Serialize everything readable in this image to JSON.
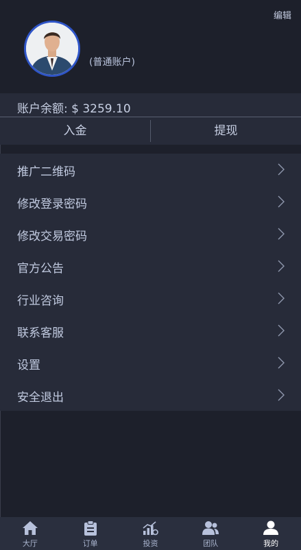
{
  "header": {
    "edit_label": "编辑",
    "account_type": "(普通账户)"
  },
  "balance": {
    "text": "账户余额: $ 3259.10"
  },
  "actions": {
    "deposit": "入金",
    "withdraw": "提现"
  },
  "menu": {
    "items": [
      {
        "label": "推广二维码"
      },
      {
        "label": "修改登录密码"
      },
      {
        "label": "修改交易密码"
      },
      {
        "label": "官方公告"
      },
      {
        "label": "行业咨询"
      },
      {
        "label": "联系客服"
      },
      {
        "label": "设置"
      },
      {
        "label": "安全退出"
      }
    ]
  },
  "tabbar": {
    "tabs": [
      {
        "label": "大厅",
        "icon": "home-icon"
      },
      {
        "label": "订单",
        "icon": "clipboard-icon"
      },
      {
        "label": "投资",
        "icon": "chart-icon"
      },
      {
        "label": "团队",
        "icon": "team-icon"
      },
      {
        "label": "我的",
        "icon": "user-icon",
        "active": true
      }
    ]
  },
  "colors": {
    "background": "#1d202b",
    "panel": "#272b39",
    "avatar_border": "#2f55c8",
    "tab_active": "#ffffff"
  }
}
